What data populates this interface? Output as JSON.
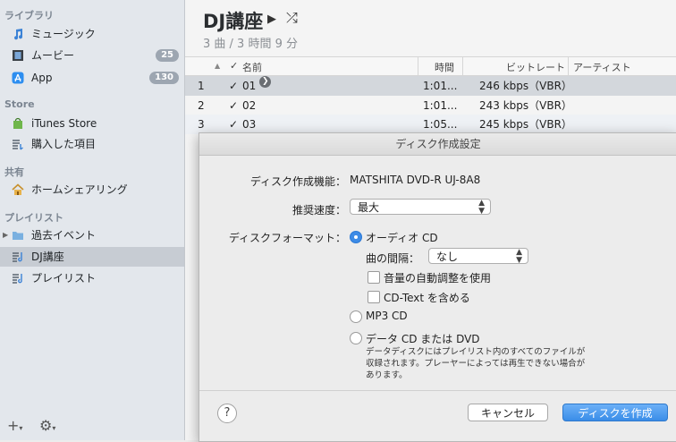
{
  "sidebar": {
    "library_header": "ライブラリ",
    "library_items": [
      {
        "label": "ミュージック",
        "icon": "music-note-icon",
        "badge": ""
      },
      {
        "label": "ムービー",
        "icon": "film-icon",
        "badge": "25"
      },
      {
        "label": "App",
        "icon": "app-store-icon",
        "badge": "130"
      }
    ],
    "store_header": "Store",
    "store_items": [
      {
        "label": "iTunes Store",
        "icon": "store-bag-icon"
      },
      {
        "label": "購入した項目",
        "icon": "purchased-list-icon"
      }
    ],
    "shared_header": "共有",
    "shared_items": [
      {
        "label": "ホームシェアリング",
        "icon": "home-icon"
      }
    ],
    "playlists_header": "プレイリスト",
    "playlist_items": [
      {
        "label": "過去イベント",
        "icon": "folder-icon"
      },
      {
        "label": "DJ講座",
        "icon": "playlist-icon"
      },
      {
        "label": "プレイリスト",
        "icon": "playlist-icon"
      }
    ]
  },
  "playlist": {
    "title": "DJ講座",
    "summary": "3 曲 / 3 時間 9 分"
  },
  "table": {
    "headers": {
      "check": "✓",
      "name": "名前",
      "time": "時間",
      "bitrate": "ビットレート",
      "artist": "アーティスト"
    },
    "rows": [
      {
        "num": "1",
        "name": "01",
        "time": "1:01...",
        "bitrate": "246 kbps（VBR）"
      },
      {
        "num": "2",
        "name": "02",
        "time": "1:01...",
        "bitrate": "243 kbps（VBR）"
      },
      {
        "num": "3",
        "name": "03",
        "time": "1:05...",
        "bitrate": "245 kbps（VBR）"
      }
    ]
  },
  "dialog": {
    "title": "ディスク作成設定",
    "drive_label": "ディスク作成機能：",
    "drive_value": "MATSHITA DVD-R   UJ-8A8",
    "speed_label": "推奨速度：",
    "speed_value": "最大",
    "format_label": "ディスクフォーマット：",
    "audio_cd": "オーディオ CD",
    "gap_label": "曲の間隔：",
    "gap_value": "なし",
    "sound_check": "音量の自動調整を使用",
    "cd_text": "CD-Text を含める",
    "mp3_cd": "MP3 CD",
    "data_cd": "データ CD または DVD",
    "data_note_1": "データディスクにはプレイリスト内のすべてのファイルが",
    "data_note_2": "収録されます。プレーヤーによっては再生できない場合が",
    "data_note_3": "あります。",
    "help": "?",
    "cancel": "キャンセル",
    "create": "ディスクを作成"
  },
  "colors": {
    "accent": "#3d8be6",
    "selection": "#c7ccd3"
  }
}
